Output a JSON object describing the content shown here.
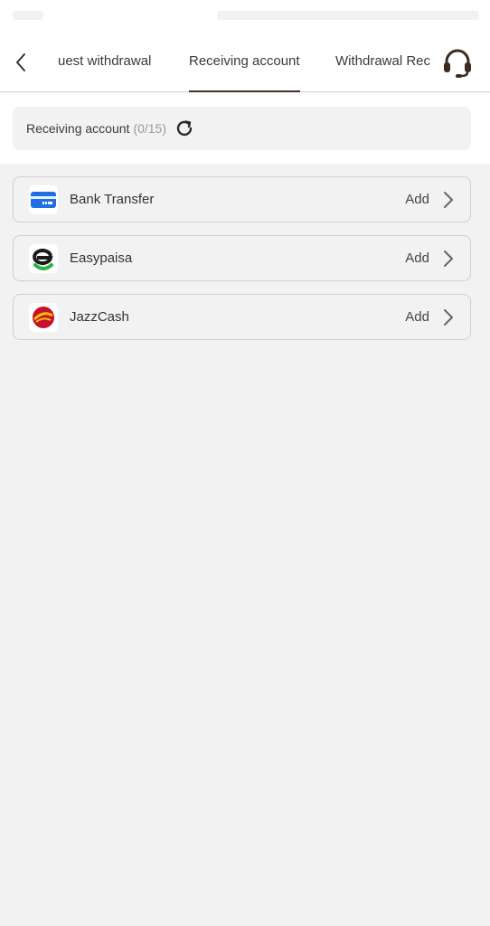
{
  "header": {
    "tabs": [
      {
        "label": "uest withdrawal",
        "active": false
      },
      {
        "label": "Receiving account",
        "active": true
      },
      {
        "label": "Withdrawal Rec",
        "active": false
      }
    ]
  },
  "summary": {
    "label": "Receiving account",
    "count": "(0/15)"
  },
  "methods": [
    {
      "name": "Bank Transfer",
      "action": "Add",
      "icon": "bank-card-icon"
    },
    {
      "name": "Easypaisa",
      "action": "Add",
      "icon": "easypaisa-logo"
    },
    {
      "name": "JazzCash",
      "action": "Add",
      "icon": "jazzcash-logo"
    }
  ],
  "colors": {
    "accent": "#4a3326",
    "background": "#f2f2f2",
    "bank_blue": "#1f6fe5",
    "easypaisa_green": "#2bb24c",
    "jazzcash_red": "#c8102e",
    "jazzcash_yellow": "#f6c300"
  }
}
